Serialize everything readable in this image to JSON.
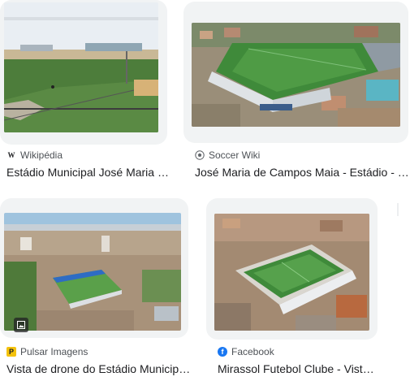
{
  "results": [
    {
      "source": "Wikipédia",
      "favicon_icon": "wikipedia-icon",
      "title": "Estádio Municipal José Maria de Campos Maia"
    },
    {
      "source": "Soccer Wiki",
      "favicon_icon": "soccer-wiki-icon",
      "title": "José Maria de Campos Maia - Estádio - Soccer Wiki"
    },
    {
      "source": "Pulsar Imagens",
      "favicon_icon": "pulsar-imagens-icon",
      "title": "Vista de drone do Estádio Municipal José Maria de Campos Maia",
      "badge_icon": "image-icon"
    },
    {
      "source": "Facebook",
      "favicon_icon": "facebook-icon",
      "title": "Mirassol Futebol Clube - Vista aérea"
    }
  ],
  "colors": {
    "pitch_green": "#3f8a3a",
    "facebook_blue": "#1877f2",
    "pulsar_yellow": "#f4c20d"
  }
}
